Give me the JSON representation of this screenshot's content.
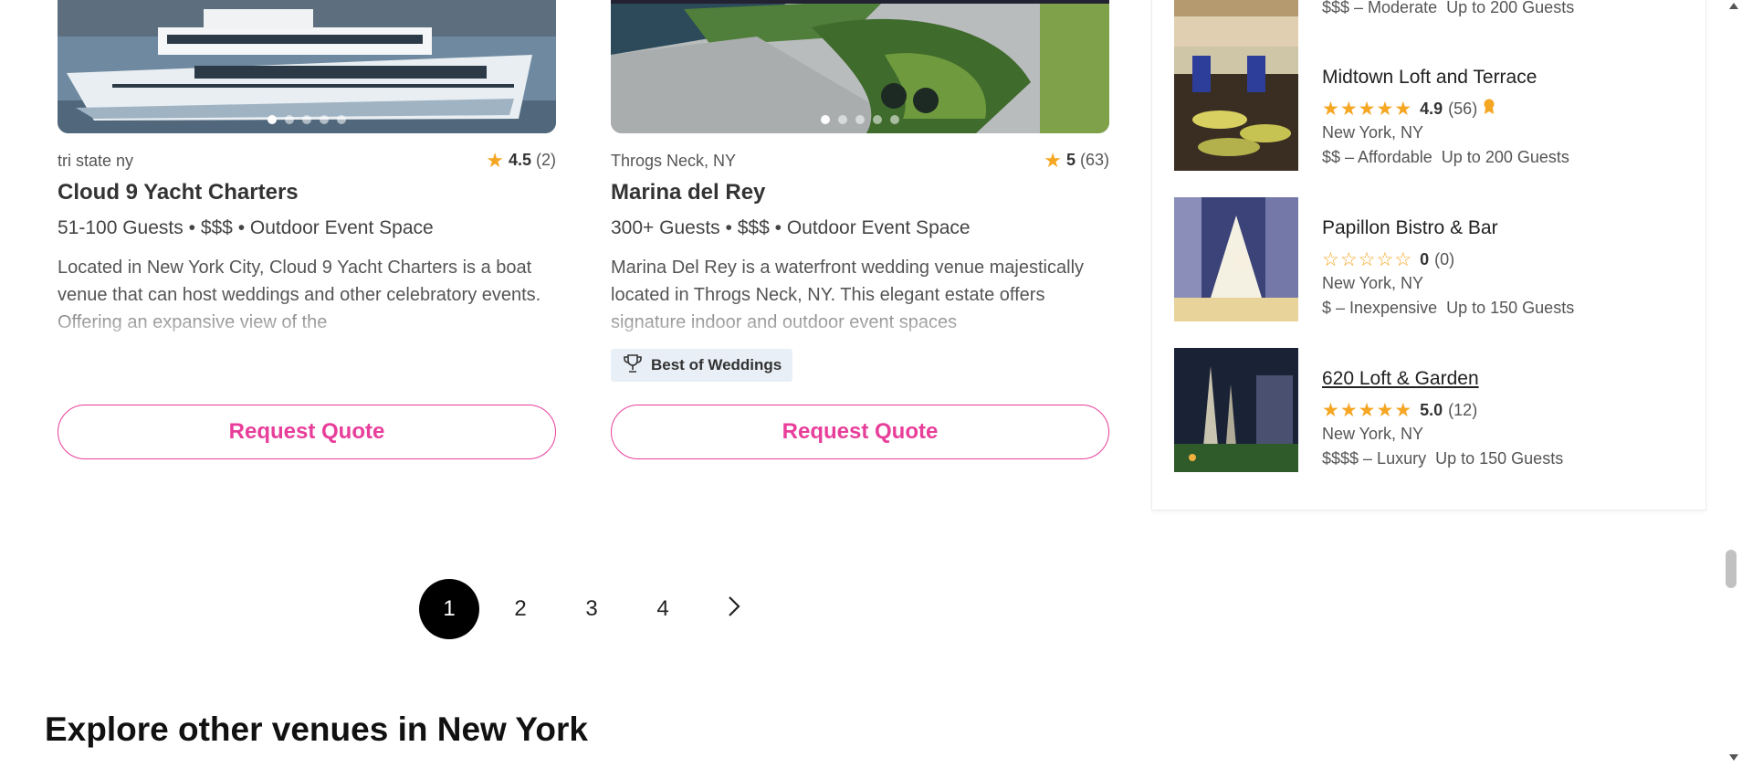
{
  "listings": [
    {
      "location": "tri state ny",
      "rating": "4.5",
      "reviews": "(2)",
      "name": "Cloud 9 Yacht Charters",
      "capacity": "51-100 Guests",
      "price": "$$$",
      "type": "Outdoor Event Space",
      "description": "Located in New York City, Cloud 9 Yacht Charters is a boat venue that can host weddings and other celebratory events. Offering an expansive view of the",
      "cta": "Request Quote"
    },
    {
      "location": "Throgs Neck, NY",
      "rating": "5",
      "reviews": "(63)",
      "name": "Marina del Rey",
      "capacity": "300+ Guests",
      "price": "$$$",
      "type": "Outdoor Event Space",
      "description": "Marina Del Rey is a waterfront wedding venue majestically located in Throgs Neck, NY. This elegant estate offers signature indoor and outdoor event spaces",
      "badge": "Best of Weddings",
      "cta": "Request Quote"
    }
  ],
  "meta_separator": "•",
  "sidebar": {
    "top_partial_price": "$$$ – Moderate",
    "top_partial_guests": "Up to 200 Guests",
    "items": [
      {
        "name": "Midtown Loft and Terrace",
        "rating": "4.9",
        "reviews": "(56)",
        "stars": 5,
        "city": "New York, NY",
        "price": "$$ – Affordable",
        "guests": "Up to 200 Guests",
        "award": true
      },
      {
        "name": "Papillon Bistro & Bar",
        "rating": "0",
        "reviews": "(0)",
        "stars": 0,
        "city": "New York, NY",
        "price": "$ – Inexpensive",
        "guests": "Up to 150 Guests"
      },
      {
        "name": "620 Loft & Garden",
        "rating": "5.0",
        "reviews": "(12)",
        "stars": 5,
        "city": "New York, NY",
        "price": "$$$$ – Luxury",
        "guests": "Up to 150 Guests"
      }
    ]
  },
  "pagination": {
    "pages": [
      "1",
      "2",
      "3",
      "4"
    ],
    "current": "1",
    "next_icon": "chevron-right-icon"
  },
  "section_heading": "Explore other venues in New York",
  "colors": {
    "accent": "#e83e9a",
    "star": "#f5a623",
    "badge_bg": "#e9eff6"
  }
}
